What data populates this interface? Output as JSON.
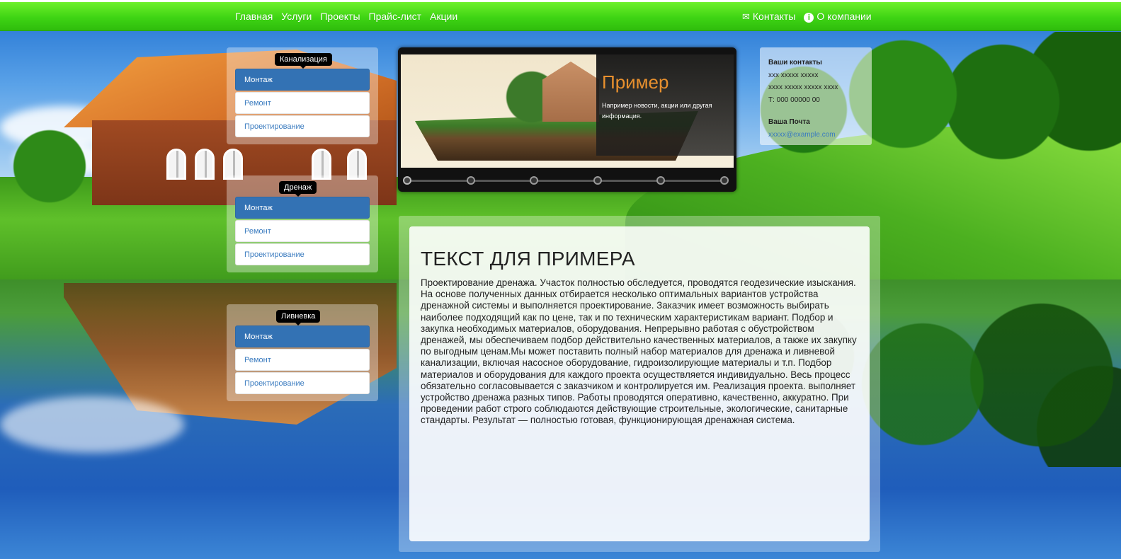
{
  "nav": {
    "left": [
      "Главная",
      "Услуги",
      "Проекты",
      "Прайс-лист",
      "Акции"
    ],
    "contacts_label": "Контакты",
    "about_label": "О компании",
    "contacts_icon": "envelope-icon",
    "about_icon": "info-circle-icon",
    "accent_color": "#3ed414"
  },
  "panels": [
    {
      "title": "Канализация",
      "items": [
        "Монтаж",
        "Ремонт",
        "Проектирование"
      ]
    },
    {
      "title": "Дренаж",
      "items": [
        "Монтаж",
        "Ремонт",
        "Проектирование"
      ]
    },
    {
      "title": "Ливневка",
      "items": [
        "Монтаж",
        "Ремонт",
        "Проектирование"
      ]
    }
  ],
  "slider": {
    "title": "Пример",
    "text": "Например новости, акции или другая информация.",
    "dot_count": 6,
    "active_dot": 1,
    "title_color": "#e8902e"
  },
  "contacts": {
    "heading": "Ваши контакты",
    "line1": "ххх ххххх ххххх",
    "line2": "хххх ххххх ххххх хххх",
    "phone": "Т: 000 00000 00",
    "mail_heading": "Ваша Почта",
    "email": "xxxxx@example.com"
  },
  "content": {
    "title": "ТЕКСТ ДЛЯ ПРИМЕРА",
    "body": "Проектирование дренажа. Участок полностью обследуется, проводятся геодезические изыскания. На основе полученных данных отбирается несколько оптимальных вариантов устройства дренажной системы и выполняется проектирование. Заказчик имеет возможность выбирать наиболее подходящий как по цене, так и по техническим характеристикам вариант. Подбор и закупка необходимых материалов, оборудования. Непрерывно работая с обустройством дренажей, мы обеспечиваем подбор действительно качественных материалов, а также их закупку по выгодным ценам.Мы может поставить полный набор материалов для дренажа и ливневой канализации, включая насосное оборудование, гидроизолирующие материалы и т.п. Подбор материалов и оборудования для каждого проекта осуществляется индивидуально. Весь процесс обязательно согласовывается с заказчиком и контролируется им. Реализация проекта. выполняет устройство дренажа разных типов. Работы проводятся оперативно, качественно, аккуратно. При проведении работ строго соблюдаются действующие строительные, экологические, санитарные стандарты. Результат — полностью готовая, функционирующая дренажная система."
  }
}
